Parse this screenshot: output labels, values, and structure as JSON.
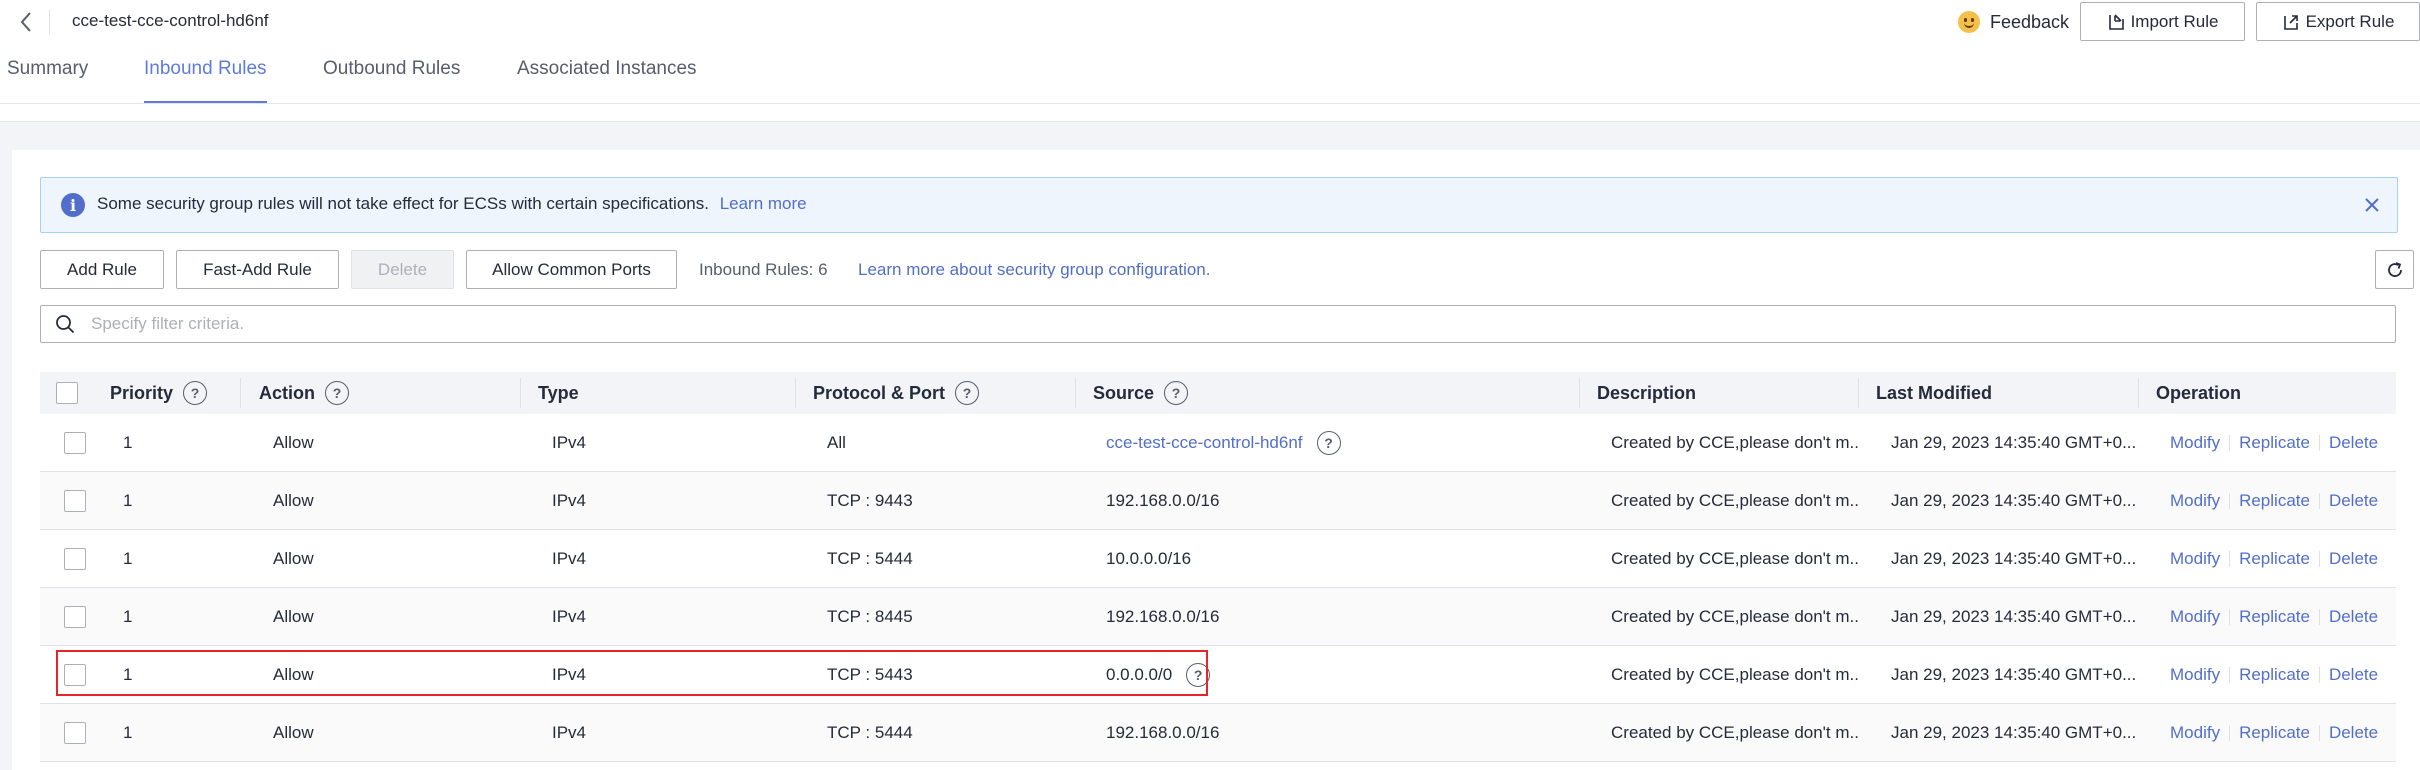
{
  "header": {
    "title": "cce-test-cce-control-hd6nf",
    "feedback": "Feedback",
    "import_rule": "Import Rule",
    "export_rule": "Export Rule"
  },
  "tabs": [
    {
      "label": "Summary",
      "active": false
    },
    {
      "label": "Inbound Rules",
      "active": true
    },
    {
      "label": "Outbound Rules",
      "active": false
    },
    {
      "label": "Associated Instances",
      "active": false
    }
  ],
  "notice": {
    "text": "Some security group rules will not take effect for ECSs with certain specifications.",
    "link": "Learn more"
  },
  "toolbar": {
    "add_rule": "Add Rule",
    "fast_add_rule": "Fast-Add Rule",
    "delete": "Delete",
    "allow_common_ports": "Allow Common Ports",
    "rule_count": "Inbound Rules: 6",
    "learn_more": "Learn more about security group configuration."
  },
  "search": {
    "placeholder": "Specify filter criteria."
  },
  "table": {
    "columns": [
      "Priority",
      "Action",
      "Type",
      "Protocol & Port",
      "Source",
      "Description",
      "Last Modified",
      "Operation"
    ],
    "operations": [
      "Modify",
      "Replicate",
      "Delete"
    ],
    "rows": [
      {
        "priority": "1",
        "action": "Allow",
        "type": "IPv4",
        "protocol_port": "All",
        "source": "cce-test-cce-control-hd6nf",
        "source_is_link": true,
        "description": "Created by CCE,please don't m...",
        "last_modified": "Jan 29, 2023 14:35:40 GMT+0..."
      },
      {
        "priority": "1",
        "action": "Allow",
        "type": "IPv4",
        "protocol_port": "TCP : 9443",
        "source": "192.168.0.0/16",
        "source_is_link": false,
        "description": "Created by CCE,please don't m...",
        "last_modified": "Jan 29, 2023 14:35:40 GMT+0..."
      },
      {
        "priority": "1",
        "action": "Allow",
        "type": "IPv4",
        "protocol_port": "TCP : 5444",
        "source": "10.0.0.0/16",
        "source_is_link": false,
        "description": "Created by CCE,please don't m...",
        "last_modified": "Jan 29, 2023 14:35:40 GMT+0..."
      },
      {
        "priority": "1",
        "action": "Allow",
        "type": "IPv4",
        "protocol_port": "TCP : 8445",
        "source": "192.168.0.0/16",
        "source_is_link": false,
        "description": "Created by CCE,please don't m...",
        "last_modified": "Jan 29, 2023 14:35:40 GMT+0..."
      },
      {
        "priority": "1",
        "action": "Allow",
        "type": "IPv4",
        "protocol_port": "TCP : 5443",
        "source": "0.0.0.0/0",
        "source_is_link": false,
        "source_help": true,
        "description": "Created by CCE,please don't m...",
        "last_modified": "Jan 29, 2023 14:35:40 GMT+0..."
      },
      {
        "priority": "1",
        "action": "Allow",
        "type": "IPv4",
        "protocol_port": "TCP : 5444",
        "source": "192.168.0.0/16",
        "source_is_link": false,
        "description": "Created by CCE,please don't m...",
        "last_modified": "Jan 29, 2023 14:35:40 GMT+0..."
      }
    ]
  },
  "colors": {
    "accent": "#5e7ce0",
    "link": "#526ecc",
    "highlight": "#e5252a",
    "notice_bg": "#eef5fd"
  }
}
